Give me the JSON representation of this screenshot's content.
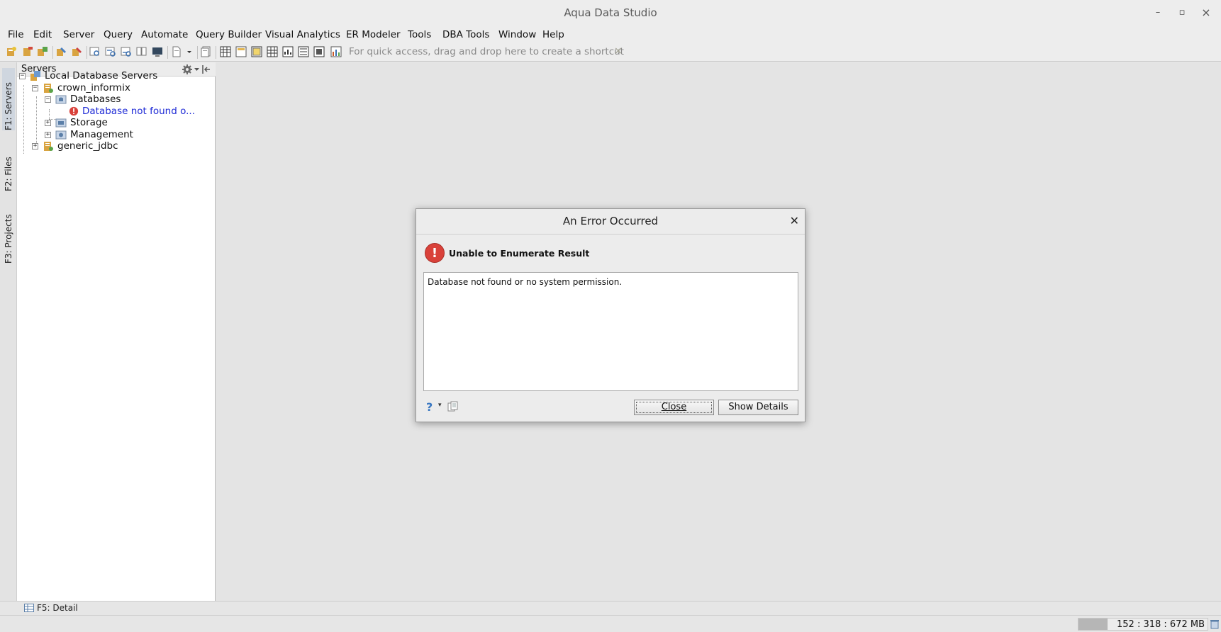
{
  "window": {
    "title": "Aqua Data Studio",
    "controls": [
      "–",
      "▫",
      "×"
    ]
  },
  "menu": {
    "items": [
      "File",
      "Edit",
      "Server",
      "Query",
      "Automate",
      "Query Builder",
      "Visual Analytics",
      "ER Modeler",
      "Tools",
      "DBA Tools",
      "Window",
      "Help"
    ]
  },
  "toolbar": {
    "shortcut_hint": "For quick access, drag and drop here to create a shortcut",
    "hint_close": "×"
  },
  "dock_tabs": {
    "servers": "F1: Servers",
    "files": "F2: Files",
    "projects": "F3: Projects"
  },
  "servers_panel": {
    "title": "Servers",
    "tree": {
      "root": "Local Database Servers",
      "server1": "crown_informix",
      "databases": "Database s",
      "databases_label": "Databases",
      "db_error": "Database not found o...",
      "storage": "Storage",
      "management": "Management",
      "server2": "generic_jdbc"
    }
  },
  "bottom": {
    "detail_tab": "F5: Detail",
    "memory": "152 : 318 : 672 MB",
    "memory_used_fraction": 0.226
  },
  "dialog": {
    "title": "An Error Occurred",
    "heading": "Unable to Enumerate Result",
    "message": "Database not found or no system permission.",
    "close_button": "Close",
    "details_button": "Show Details",
    "help_icon": "?"
  },
  "colors": {
    "error_red": "#d9413a",
    "link_blue": "#1f2bd6"
  }
}
